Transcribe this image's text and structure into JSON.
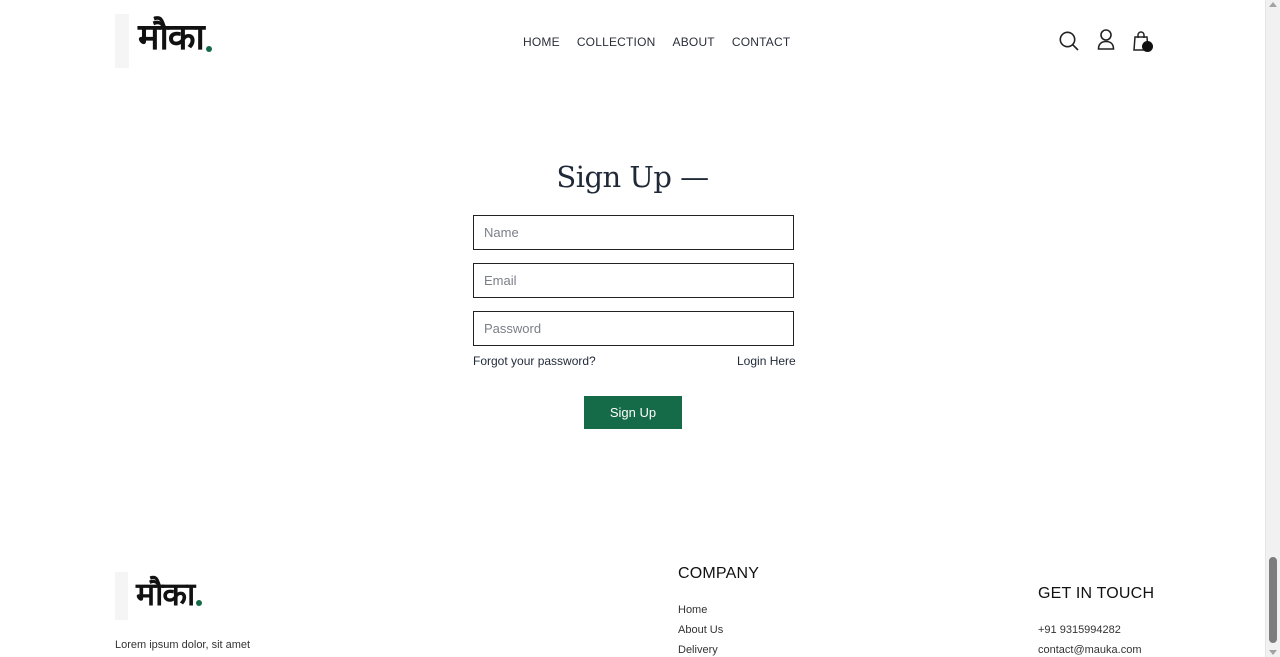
{
  "brand": {
    "logo_text": "मौका",
    "accent_color": "#156a48"
  },
  "nav": {
    "items": [
      "HOME",
      "COLLECTION",
      "ABOUT",
      "CONTACT"
    ]
  },
  "header_icons": [
    "search-icon",
    "user-icon",
    "shopping-bag-icon"
  ],
  "form": {
    "title": "Sign Up —",
    "name_placeholder": "Name",
    "email_placeholder": "Email",
    "password_placeholder": "Password",
    "forgot_label": "Forgot your password?",
    "login_label": "Login Here",
    "submit_label": "Sign Up"
  },
  "footer": {
    "tagline": "Lorem ipsum dolor, sit amet",
    "company_heading": "COMPANY",
    "company_links": [
      "Home",
      "About Us",
      "Delivery"
    ],
    "contact_heading": "GET IN TOUCH",
    "phone": "+91 9315994282",
    "email": "contact@mauka.com"
  }
}
